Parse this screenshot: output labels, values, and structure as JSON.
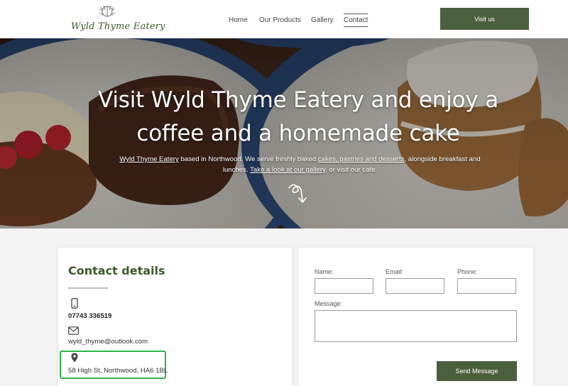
{
  "header": {
    "logo_text": "Wyld Thyme Eatery",
    "nav": [
      "Home",
      "Our Products",
      "Gallery",
      "Contact"
    ],
    "active_nav": "Contact",
    "cta_label": "Visit us"
  },
  "hero": {
    "title": "Visit Wyld Thyme Eatery and enjoy a coffee and a homemade cake",
    "desc_link1": "Wyld Thyme Eatery",
    "desc_part1": " based in Northwood. We serve freshly baked ",
    "desc_link2": "cakes, pastries and desserts",
    "desc_part2": ", alongside breakfast and lunches. ",
    "desc_link3": "Take a look at our gallery",
    "desc_part3": ", or visit our cafe."
  },
  "contact": {
    "title": "Contact details",
    "phone": "07743 336519",
    "email": "wyld_thyme@outlook.com",
    "address": "58 High St, Northwood, HA6 1BL"
  },
  "form": {
    "name_label": "Name:",
    "email_label": "Email:",
    "phone_label": "Phone:",
    "message_label": "Message:",
    "name_value": "",
    "email_value": "",
    "phone_value": "",
    "message_value": "",
    "send_label": "Send Message"
  },
  "colors": {
    "brand_green": "#4a5f3c",
    "logo_green": "#3c5a2b",
    "highlight": "#2fb34a"
  }
}
